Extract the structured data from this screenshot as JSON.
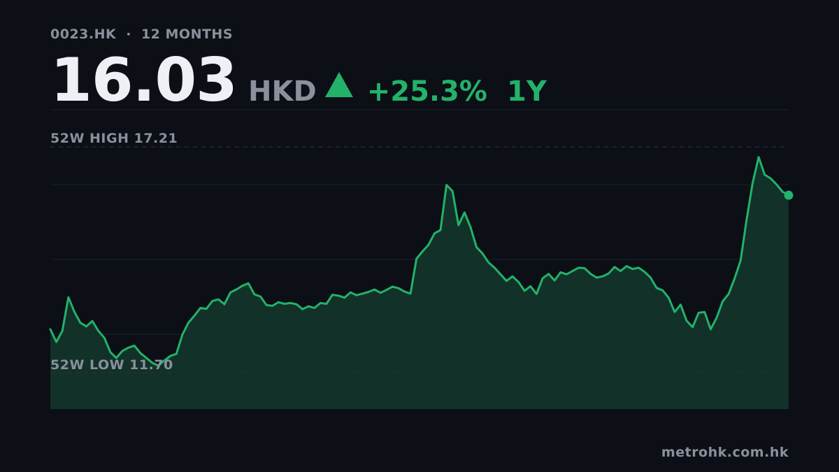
{
  "header": {
    "ticker": "0023.HK",
    "separator": "·",
    "period_label": "12 MONTHS"
  },
  "price": {
    "value": "16.03",
    "currency": "HKD",
    "direction_icon": "triangle-up-icon",
    "change_pct": "+25.3%",
    "change_period": "1Y"
  },
  "colors": {
    "background": "#0c0f16",
    "line": "#23b26a",
    "area_fill": "#123128",
    "grid": "#1c212b",
    "muted_text": "#8a909c",
    "price_text": "#eef0f5"
  },
  "footer": {
    "domain": "metrohk.com.hk"
  },
  "chart_data": {
    "type": "area",
    "title": "",
    "xlabel": "",
    "ylabel": "",
    "ylim": [
      10.7,
      17.21
    ],
    "grid": true,
    "high_label": "52W HIGH",
    "high_value": 17.21,
    "high_value_text": "17.21",
    "low_label": "52W LOW",
    "low_value": 11.7,
    "low_value_text": "11.70",
    "last_value": 16.03,
    "series": [
      {
        "values": [
          12.76,
          12.45,
          12.72,
          13.54,
          13.19,
          12.92,
          12.83,
          12.96,
          12.72,
          12.55,
          12.2,
          12.06,
          12.23,
          12.31,
          12.36,
          12.18,
          12.06,
          11.94,
          11.87,
          12.0,
          12.11,
          12.16,
          12.63,
          12.92,
          13.09,
          13.28,
          13.26,
          13.45,
          13.49,
          13.37,
          13.66,
          13.73,
          13.82,
          13.88,
          13.61,
          13.56,
          13.35,
          13.33,
          13.42,
          13.38,
          13.4,
          13.37,
          13.25,
          13.32,
          13.28,
          13.4,
          13.38,
          13.6,
          13.58,
          13.53,
          13.66,
          13.59,
          13.63,
          13.67,
          13.73,
          13.65,
          13.72,
          13.8,
          13.76,
          13.68,
          13.63,
          14.48,
          14.66,
          14.82,
          15.1,
          15.18,
          16.28,
          16.13,
          15.3,
          15.61,
          15.25,
          14.76,
          14.61,
          14.39,
          14.26,
          14.1,
          13.94,
          14.05,
          13.91,
          13.7,
          13.81,
          13.62,
          14.0,
          14.11,
          13.95,
          14.15,
          14.1,
          14.18,
          14.26,
          14.25,
          14.11,
          14.02,
          14.05,
          14.12,
          14.28,
          14.18,
          14.3,
          14.23,
          14.26,
          14.16,
          14.02,
          13.77,
          13.71,
          13.53,
          13.18,
          13.36,
          12.97,
          12.81,
          13.16,
          13.18,
          12.76,
          13.04,
          13.44,
          13.62,
          14.0,
          14.44,
          15.44,
          16.33,
          16.96,
          16.53,
          16.44,
          16.29,
          16.11,
          16.05
        ]
      }
    ]
  }
}
